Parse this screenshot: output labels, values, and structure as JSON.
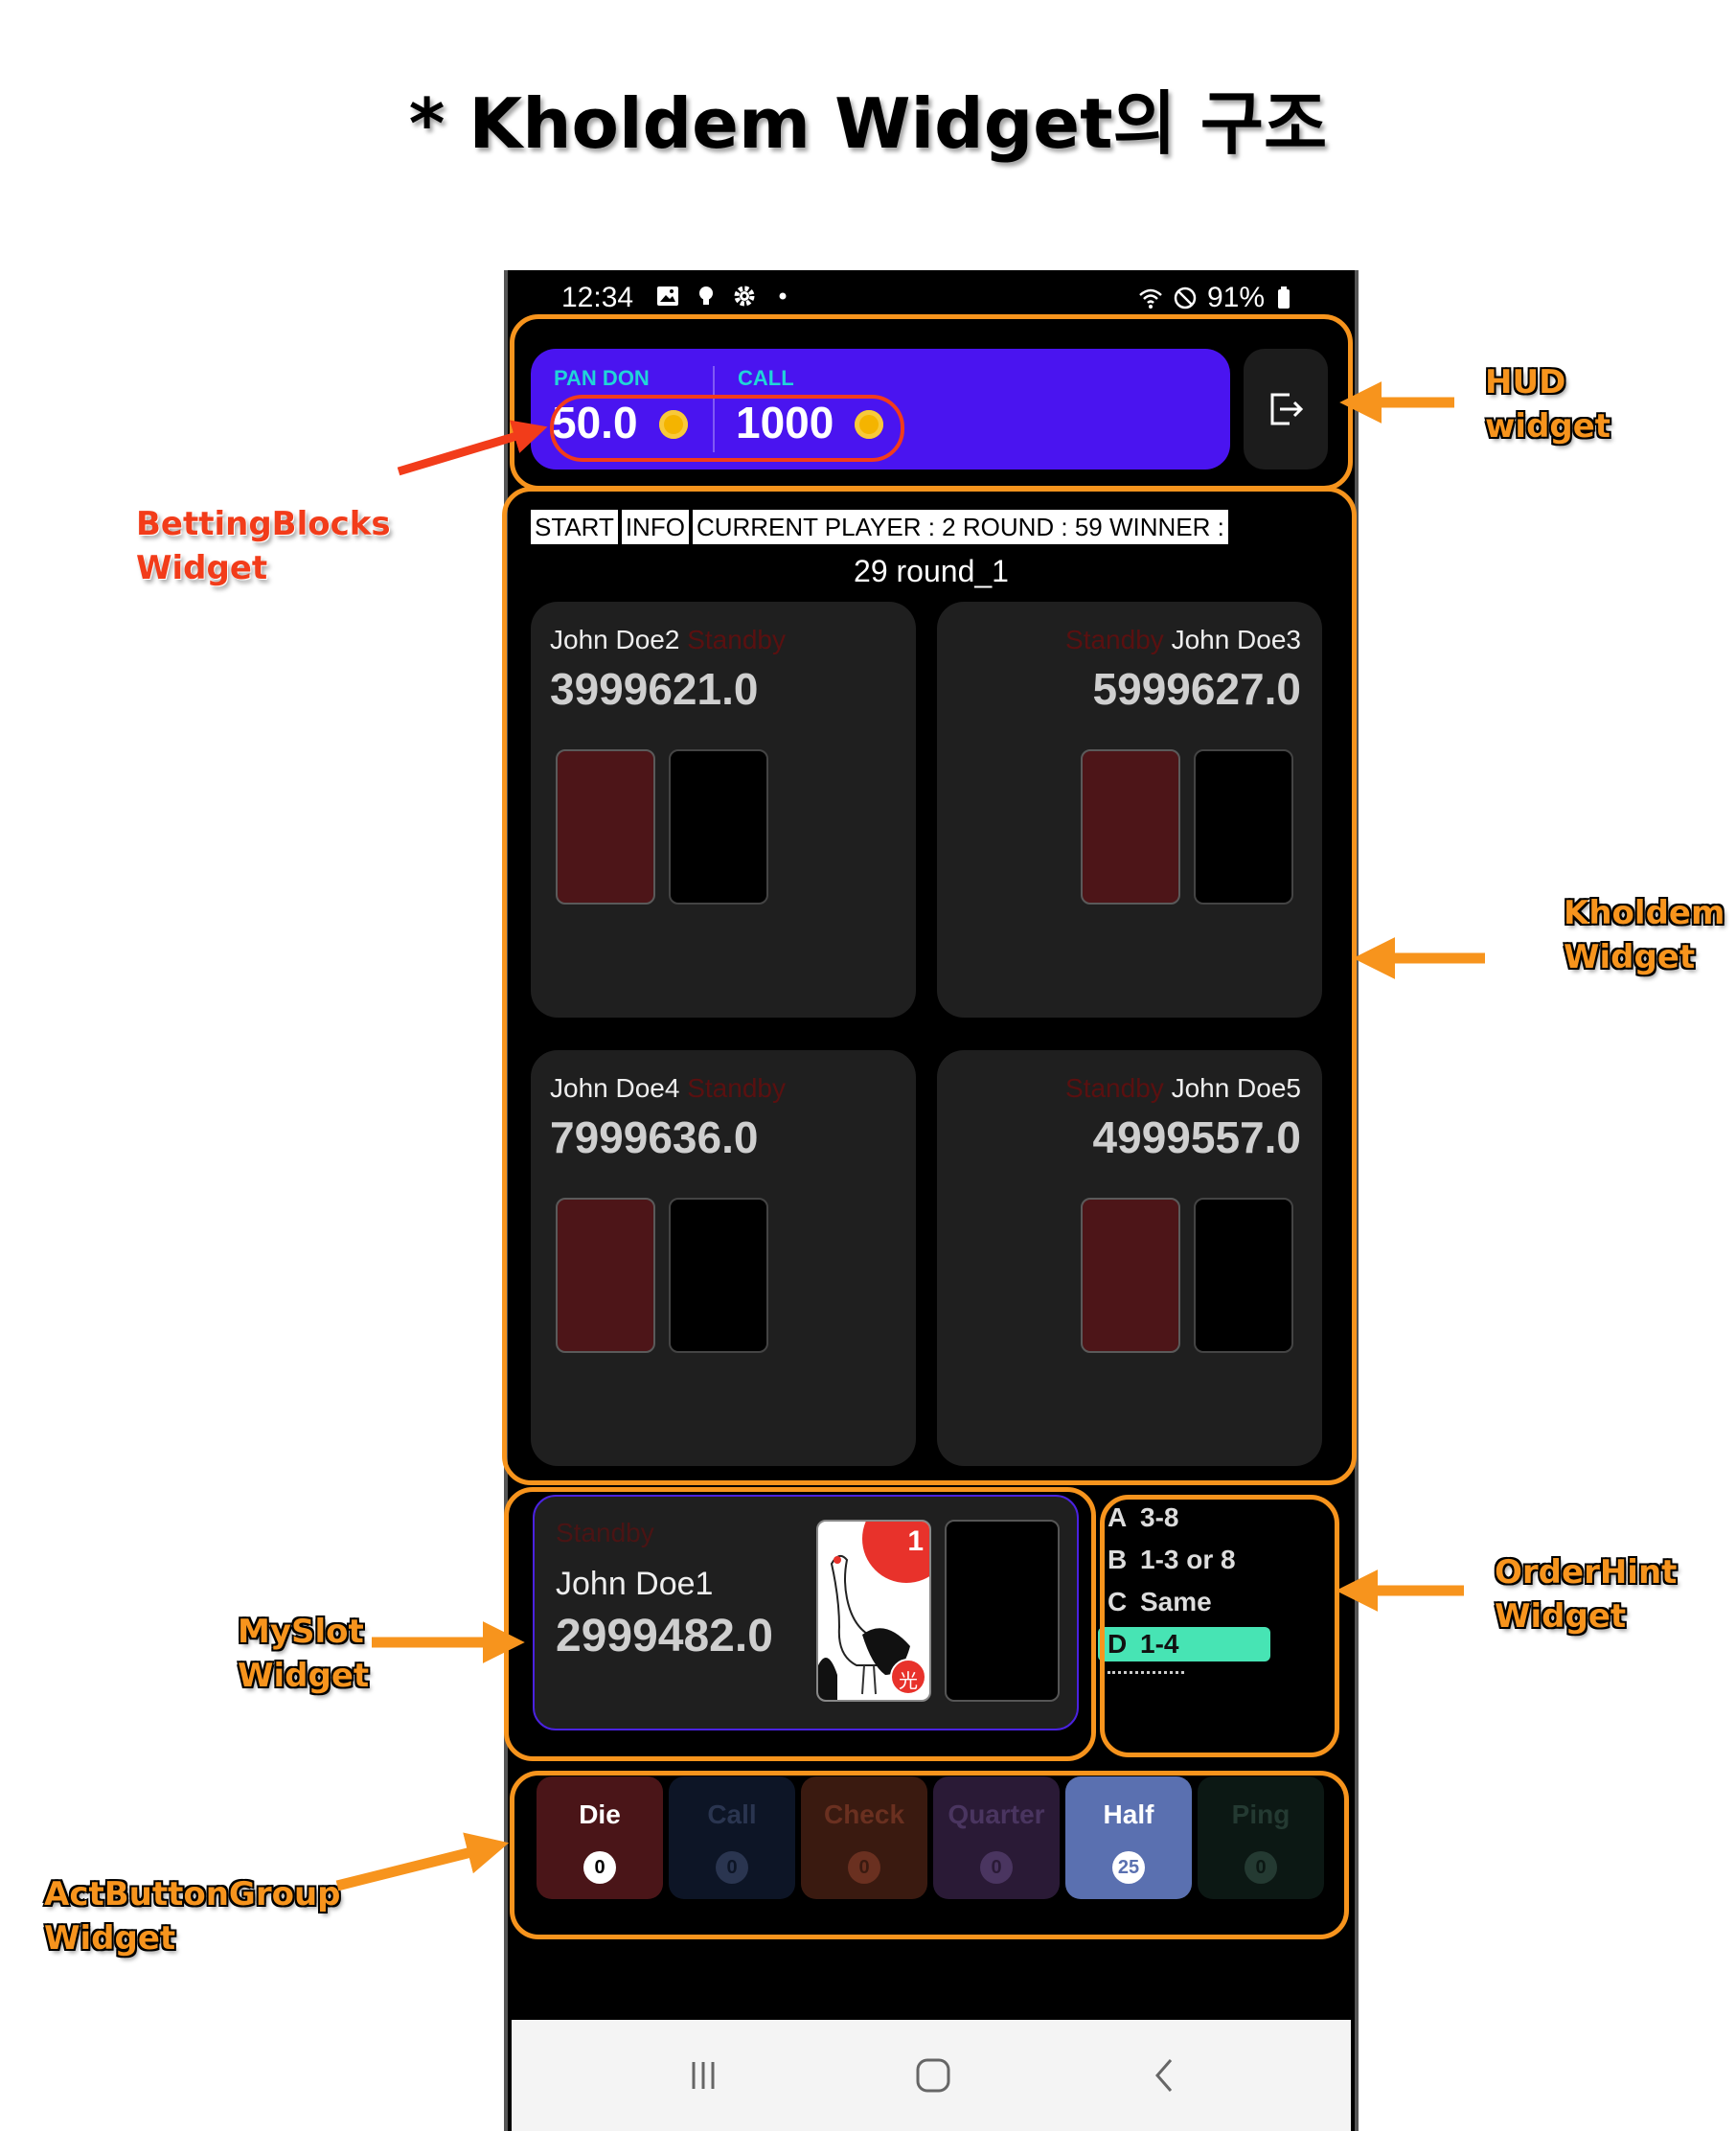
{
  "title": "* Kholdem Widget의 구조",
  "status_bar": {
    "time": "12:34",
    "battery": "91%"
  },
  "hud": {
    "pan_don_label": "PAN DON",
    "pan_don_value": "50.0",
    "call_label": "CALL",
    "call_value": "1000",
    "exit_icon": "exit-icon"
  },
  "info_bar": {
    "start": "START",
    "info": "INFO",
    "status": "CURRENT PLAYER : 2 ROUND : 59 WINNER :"
  },
  "round_text": "29 round_1",
  "players": [
    {
      "name": "John Doe2",
      "status": "Standby",
      "chips": "3999621.0"
    },
    {
      "name": "John Doe3",
      "status": "Standby",
      "chips": "5999627.0"
    },
    {
      "name": "John Doe4",
      "status": "Standby",
      "chips": "7999636.0"
    },
    {
      "name": "John Doe5",
      "status": "Standby",
      "chips": "4999557.0"
    }
  ],
  "my_slot": {
    "status": "Standby",
    "name": "John Doe1",
    "chips": "2999482.0",
    "card_number": "1",
    "card_badge": "光"
  },
  "order_hint": [
    {
      "key": "A",
      "value": "3-8",
      "active": false
    },
    {
      "key": "B",
      "value": "1-3 or 8",
      "active": false
    },
    {
      "key": "C",
      "value": "Same",
      "active": false
    },
    {
      "key": "D",
      "value": "1-4",
      "active": true
    }
  ],
  "act_buttons": [
    {
      "label": "Die",
      "count": "0"
    },
    {
      "label": "Call",
      "count": "0"
    },
    {
      "label": "Check",
      "count": "0"
    },
    {
      "label": "Quarter",
      "count": "0"
    },
    {
      "label": "Half",
      "count": "25"
    },
    {
      "label": "Ping",
      "count": "0"
    }
  ],
  "annotations": {
    "hud": [
      "HUD",
      "widget"
    ],
    "betting": [
      "BettingBlocks",
      "Widget"
    ],
    "kholdem": [
      "Kholdem",
      "Widget"
    ],
    "myslot": [
      "MySlot",
      "Widget"
    ],
    "orderhint": [
      "OrderHint",
      "Widget"
    ],
    "actbutton": [
      "ActButtonGroup",
      "Widget"
    ]
  },
  "colors": {
    "hud_bg": "#4a14f0",
    "hud_label": "#21d4d8",
    "annotation_frame": "#f7941d",
    "annotation_highlight": "#f23c1a",
    "order_hint_active": "#47e4b4"
  }
}
